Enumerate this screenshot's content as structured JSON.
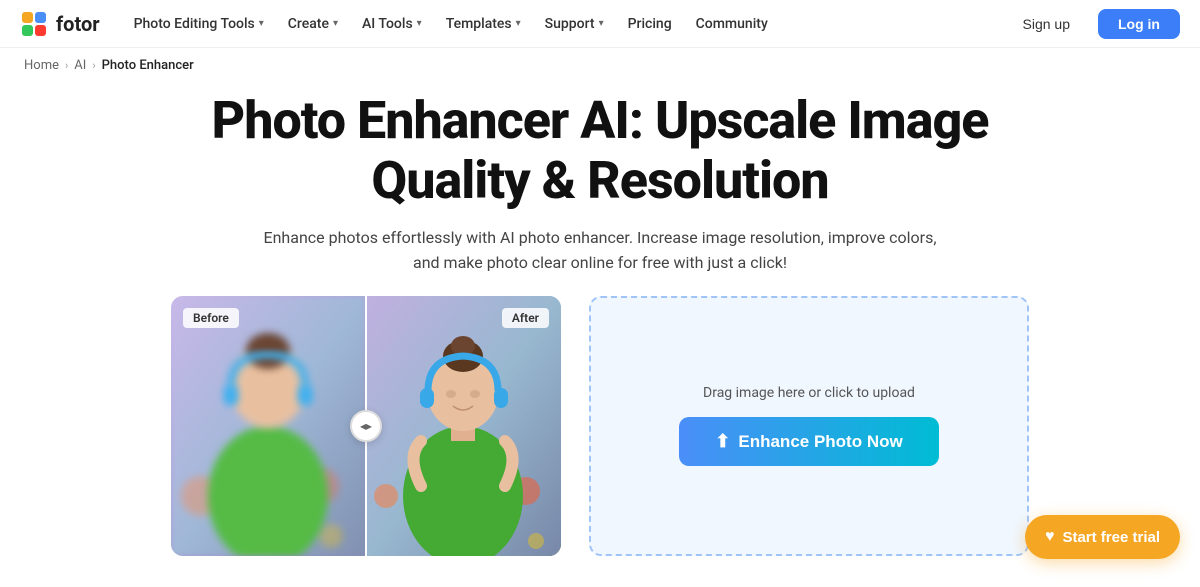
{
  "brand": {
    "name": "fotor",
    "logo_alt": "Fotor logo"
  },
  "nav": {
    "items": [
      {
        "label": "Photo Editing Tools",
        "has_dropdown": true
      },
      {
        "label": "Create",
        "has_dropdown": true
      },
      {
        "label": "AI Tools",
        "has_dropdown": true
      },
      {
        "label": "Templates",
        "has_dropdown": true
      },
      {
        "label": "Support",
        "has_dropdown": true
      },
      {
        "label": "Pricing",
        "has_dropdown": false
      },
      {
        "label": "Community",
        "has_dropdown": false
      }
    ],
    "sign_up": "Sign up",
    "log_in": "Log in"
  },
  "breadcrumb": {
    "home": "Home",
    "ai": "AI",
    "current": "Photo Enhancer"
  },
  "hero": {
    "title": "Photo Enhancer AI: Upscale Image Quality & Resolution",
    "subtitle": "Enhance photos effortlessly with AI photo enhancer. Increase image resolution, improve colors, and make photo clear online for free with just a click!"
  },
  "before_after": {
    "before_label": "Before",
    "after_label": "After"
  },
  "upload": {
    "drag_text": "Drag image here or click to upload",
    "enhance_btn": "Enhance Photo Now"
  },
  "trial": {
    "label": "Start free trial"
  }
}
